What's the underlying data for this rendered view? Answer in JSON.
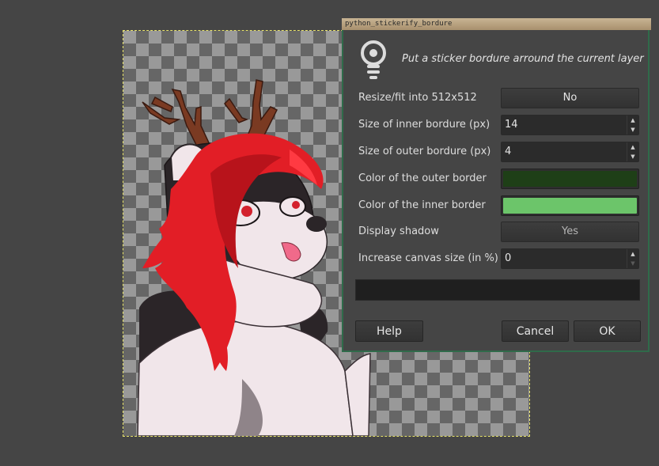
{
  "dialog": {
    "title": "python_stickerify_bordure",
    "description": "Put a sticker bordure arround the current layer",
    "fields": {
      "resize": {
        "label": "Resize/fit into 512x512",
        "value": "No"
      },
      "inner_size": {
        "label": "Size of inner bordure (px)",
        "value": "14"
      },
      "outer_size": {
        "label": "Size of outer bordure (px)",
        "value": "4"
      },
      "outer_color": {
        "label": "Color of the outer border",
        "color": "#1e3f17"
      },
      "inner_color": {
        "label": "Color of the inner border",
        "color": "#6cc56a"
      },
      "shadow": {
        "label": "Display shadow",
        "value": "Yes"
      },
      "canvas_increase": {
        "label": "Increase canvas size (in %)",
        "value": "0"
      }
    },
    "buttons": {
      "help": "Help",
      "cancel": "Cancel",
      "ok": "OK"
    }
  },
  "colors": {
    "workspace_bg": "#454545",
    "dialog_border": "#2f6b4a",
    "hair_red": "#e21e26",
    "antler_brown": "#7a3a22",
    "fur_white": "#f1e6ea",
    "fur_black": "#2b2528"
  }
}
